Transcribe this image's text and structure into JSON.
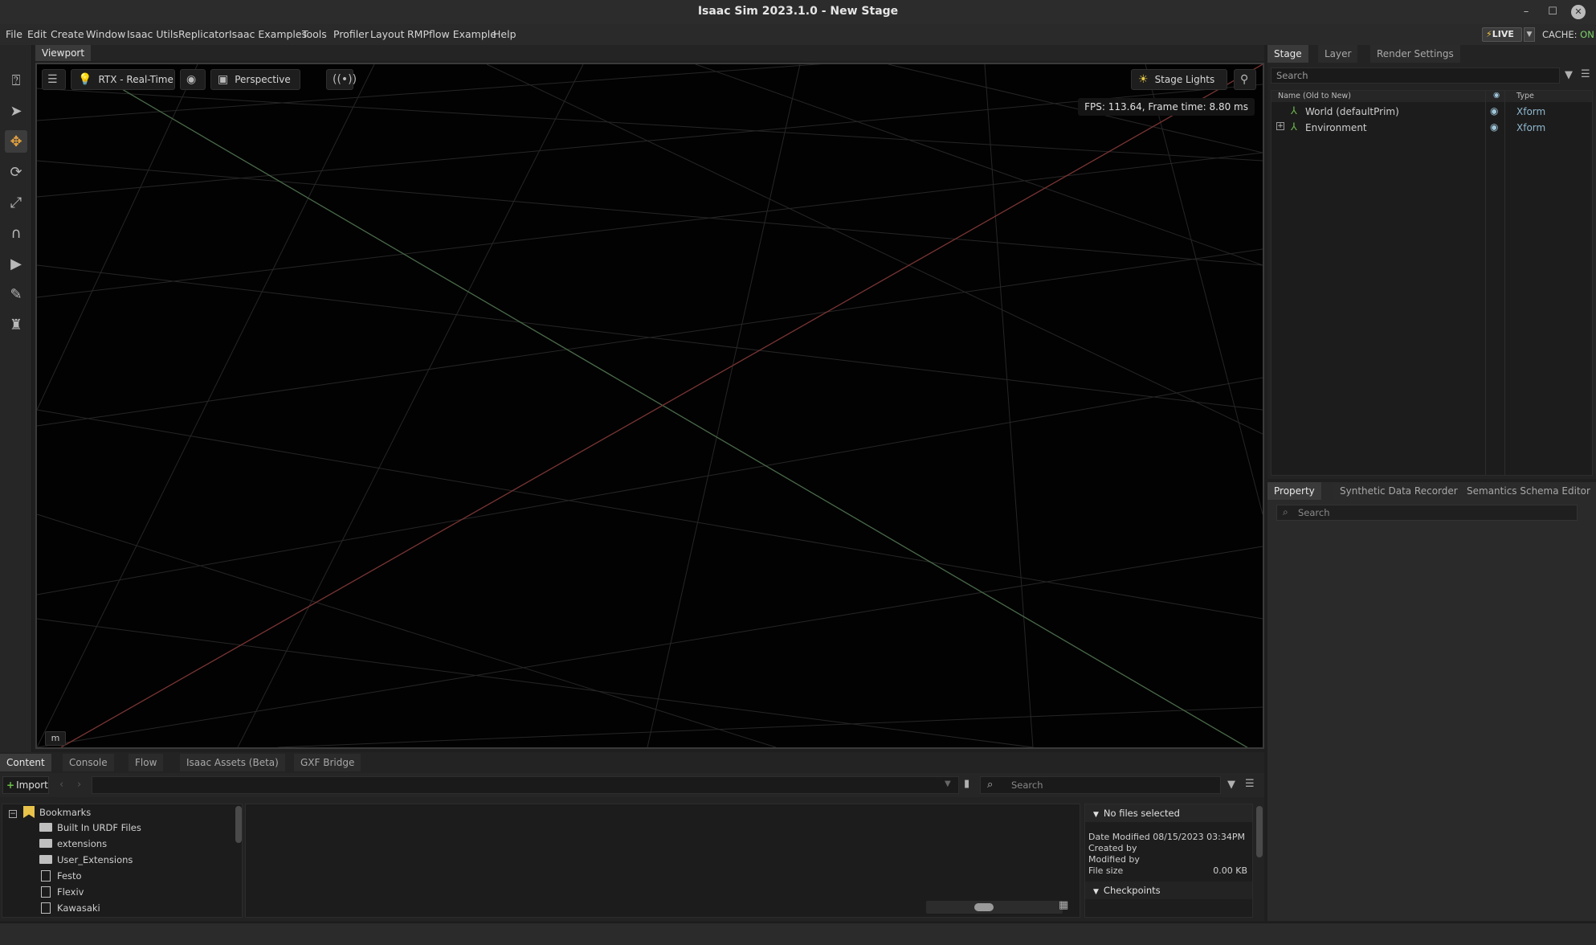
{
  "window": {
    "title": "Isaac Sim 2023.1.0 - New Stage",
    "controls": [
      "–",
      "☐",
      "✕"
    ]
  },
  "menu": {
    "items": [
      "File",
      "Edit",
      "Create",
      "Window",
      "Isaac Utils",
      "Replicator",
      "Isaac Examples",
      "Tools",
      "Profiler",
      "Layout",
      "RMPflow Example",
      "Help"
    ],
    "live_label": "LIVE",
    "cache_label": "CACHE:",
    "cache_state": "ON"
  },
  "left_toolbar": {
    "tools": [
      "help-select-icon",
      "select-arrow-icon",
      "move-icon",
      "rotate-icon",
      "scale-icon",
      "snap-magnet-icon",
      "play-icon",
      "paint-brush-icon",
      "robot-icon"
    ],
    "active_index": 2
  },
  "viewport": {
    "tab": "Viewport",
    "render_mode": "RTX - Real-Time",
    "camera": "Perspective",
    "stage_lights": "Stage Lights",
    "fps_text": "FPS: 113.64, Frame time: 8.80 ms",
    "unit": "m",
    "colors": {
      "background": "#020202",
      "grid": "#2a2a2a",
      "x_axis": "#7a3434",
      "z_axis": "#4a6a4a"
    }
  },
  "stage_panel": {
    "tabs": [
      "Stage",
      "Layer",
      "Render Settings"
    ],
    "search_placeholder": "Search",
    "columns": {
      "name": "Name (Old to New)",
      "type": "Type"
    },
    "rows": [
      {
        "name": "World (defaultPrim)",
        "type": "Xform"
      },
      {
        "name": "Environment",
        "type": "Xform",
        "expand": "+"
      }
    ]
  },
  "property_panel": {
    "tabs": [
      "Property",
      "Synthetic Data Recorder",
      "Semantics Schema Editor"
    ],
    "search_placeholder": "Search"
  },
  "content_panel": {
    "tabs": [
      "Content",
      "Console",
      "Flow",
      "Isaac Assets (Beta)",
      "GXF Bridge"
    ],
    "import_label": "Import",
    "search_placeholder": "Search",
    "tree": {
      "root": "Bookmarks",
      "items": [
        {
          "label": "Built In URDF Files",
          "kind": "folder"
        },
        {
          "label": "extensions",
          "kind": "folder"
        },
        {
          "label": "User_Extensions",
          "kind": "folder"
        },
        {
          "label": "Festo",
          "kind": "file"
        },
        {
          "label": "Flexiv",
          "kind": "file"
        },
        {
          "label": "Kawasaki",
          "kind": "file"
        }
      ]
    },
    "info": {
      "header": "No files selected",
      "date_modified": "Date Modified 08/15/2023 03:34PM",
      "created_by": "Created by",
      "modified_by": "Modified by",
      "file_size_label": "File size",
      "file_size_value": "0.00 KB",
      "checkpoints": "Checkpoints"
    }
  }
}
